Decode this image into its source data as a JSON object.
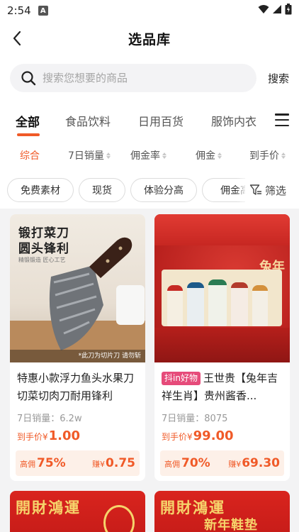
{
  "status_bar": {
    "time": "2:54",
    "app_badge": "A"
  },
  "header": {
    "title": "选品库"
  },
  "search": {
    "placeholder": "搜索您想要的商品",
    "button_label": "搜索"
  },
  "category_tabs": [
    {
      "label": "全部",
      "active": true
    },
    {
      "label": "食品饮料",
      "active": false
    },
    {
      "label": "日用百货",
      "active": false
    },
    {
      "label": "服饰内衣",
      "active": false
    }
  ],
  "sort_options": [
    {
      "label": "综合",
      "active": true
    },
    {
      "label": "7日销量",
      "active": false
    },
    {
      "label": "佣金率",
      "active": false
    },
    {
      "label": "佣金",
      "active": false
    },
    {
      "label": "到手价",
      "active": false
    }
  ],
  "filter_chips": [
    "免费素材",
    "现货",
    "体验分高",
    "佣金高"
  ],
  "filter_button": {
    "label": "筛选"
  },
  "products": [
    {
      "image_text_1": "锻打菜刀",
      "image_text_2": "圆头锋利",
      "image_text_3": "精锻锻造 匠心工艺",
      "image_note": "*此刀为切片刀 请勿斩",
      "tag": "",
      "title": "特惠小款浮力鱼头水果刀切菜切肉刀耐用锋利",
      "sales_label": "7日销量：",
      "sales_value": "6.2w",
      "price_label": "到手价¥",
      "price_value": "1.00",
      "commission_rate_label": "高佣",
      "commission_rate": "75%",
      "earn_label": "赚¥",
      "earn_value": "0.75"
    },
    {
      "image_text_1": "兔年",
      "tag": "抖in好物",
      "title": "王世贵【兔年吉祥生肖】贵州酱香...",
      "sales_label": "7日销量：",
      "sales_value": "8075",
      "price_label": "到手价¥",
      "price_value": "99.00",
      "commission_rate_label": "高佣",
      "commission_rate": "70%",
      "earn_label": "赚¥",
      "earn_value": "69.30"
    },
    {
      "image_text_1": "開財鴻運"
    },
    {
      "image_text_1": "開財鴻運",
      "image_text_2": "新年鞋垫"
    }
  ],
  "colors": {
    "accent": "#f05a28",
    "commission_bg": "#fdf0e8",
    "page_bg": "#f3f3f4",
    "tag_pink": "#e64b7a"
  }
}
